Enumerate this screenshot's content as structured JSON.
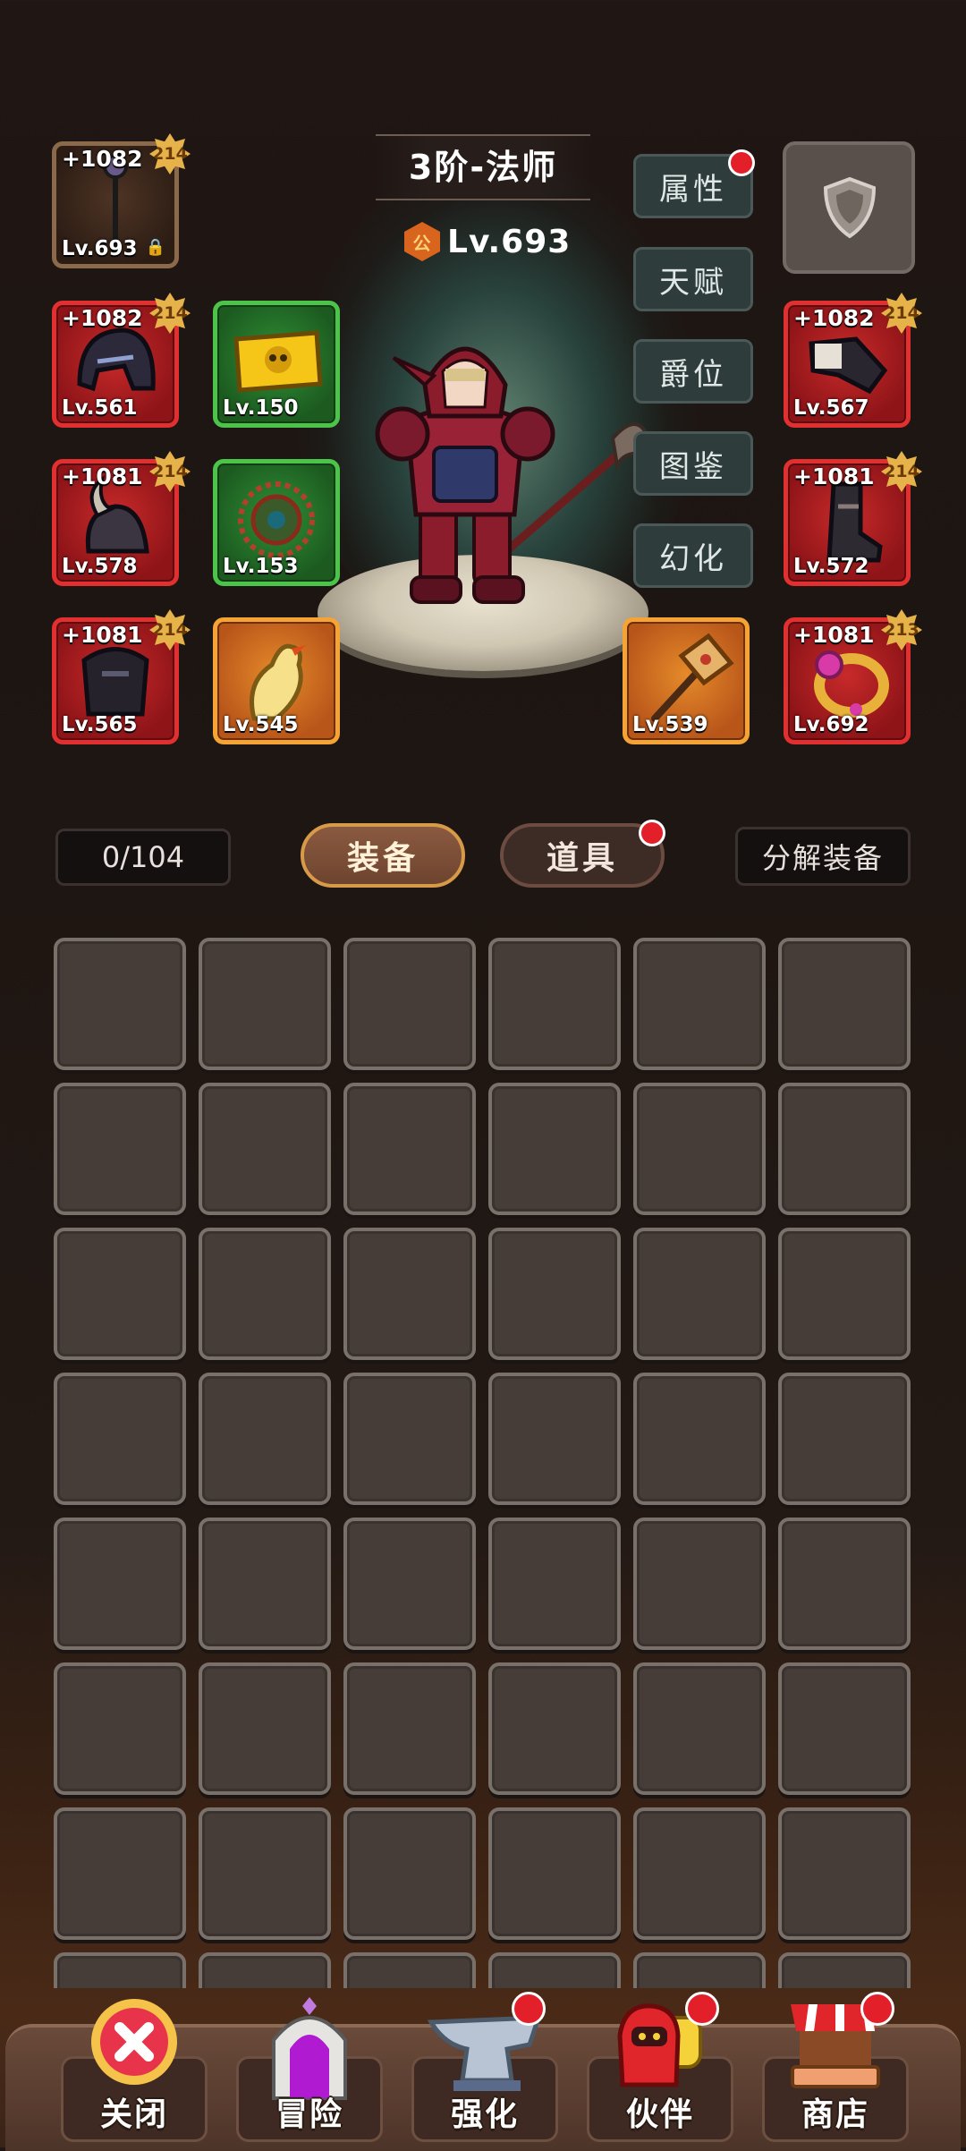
{
  "hero": {
    "class_title": "3阶-法师",
    "guild_icon_text": "公",
    "level": "Lv.693"
  },
  "left_slots": [
    {
      "plus": "+1082",
      "level": "Lv.693",
      "badge": "214",
      "locked": true,
      "rarity": "brown",
      "icon": "staff-icon"
    },
    {
      "plus": "+1082",
      "level": "Lv.561",
      "badge": "214",
      "rarity": "red",
      "icon": "helmet-icon"
    },
    {
      "plus": "+1081",
      "level": "Lv.578",
      "badge": "214",
      "rarity": "red",
      "icon": "horned-pauldron-icon"
    },
    {
      "plus": "+1081",
      "level": "Lv.565",
      "badge": "214",
      "rarity": "red",
      "icon": "chest-armor-icon"
    }
  ],
  "mid_left_slots": [
    {
      "level": "Lv.150",
      "rarity": "green",
      "icon": "skull-ticket-icon"
    },
    {
      "level": "Lv.153",
      "rarity": "green",
      "icon": "rune-wheel-icon"
    },
    {
      "level": "Lv.545",
      "rarity": "orange",
      "icon": "rubber-chicken-icon"
    }
  ],
  "mid_right_slot": {
    "level": "Lv.539",
    "rarity": "orange",
    "icon": "hammer-icon"
  },
  "right_slots": [
    {
      "plus": "+1082",
      "level": "Lv.567",
      "badge": "214",
      "rarity": "red",
      "icon": "gauntlet-icon"
    },
    {
      "plus": "+1081",
      "level": "Lv.572",
      "badge": "214",
      "rarity": "red",
      "icon": "boots-icon"
    },
    {
      "plus": "+1081",
      "level": "Lv.692",
      "badge": "213",
      "rarity": "red",
      "icon": "ring-icon"
    }
  ],
  "side_menu": [
    "属性",
    "天赋",
    "爵位",
    "图鉴",
    "幻化"
  ],
  "inventory": {
    "count": "0/104",
    "tab_equipment": "装备",
    "tab_items": "道具",
    "dismantle": "分解装备"
  },
  "bottom_nav": [
    "关闭",
    "冒险",
    "强化",
    "伙伴",
    "商店"
  ],
  "colors": {
    "notification": "#e3202a",
    "rarity_red": "#e23030",
    "rarity_green": "#4cc44a",
    "rarity_orange": "#f5a335"
  }
}
